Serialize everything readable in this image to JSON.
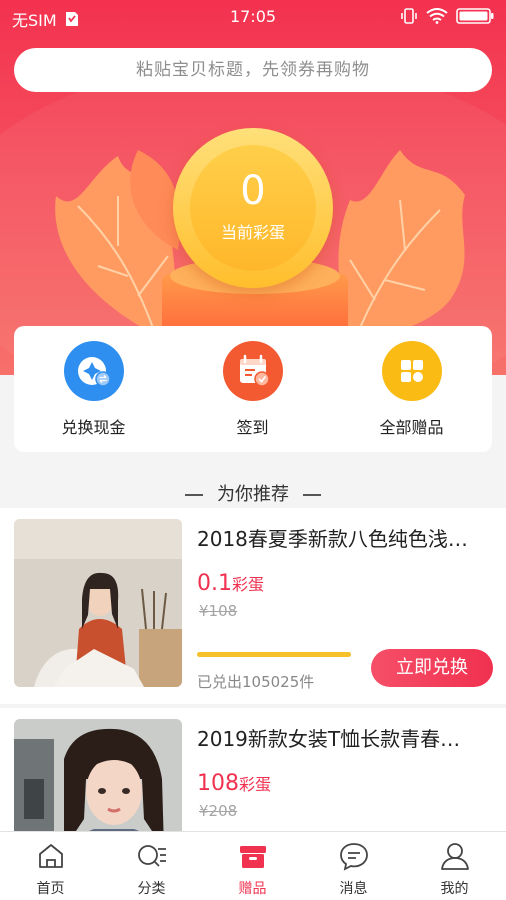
{
  "status_bar": {
    "carrier": "无SIM",
    "time": "17:05"
  },
  "search": {
    "placeholder": "粘贴宝贝标题，先领券再购物"
  },
  "balance": {
    "value": "0",
    "label": "当前彩蛋"
  },
  "actions": [
    {
      "label": "兑换现金",
      "icon": "exchange-cash-icon",
      "color": "#2f8ff0"
    },
    {
      "label": "签到",
      "icon": "calendar-checkin-icon",
      "color": "#f35a32"
    },
    {
      "label": "全部赠品",
      "icon": "grid-gifts-icon",
      "color": "#f9bb14"
    }
  ],
  "section_title": "为你推荐",
  "products": [
    {
      "title": "2018春夏季新款八色纯色浅…",
      "price": "0.1",
      "price_unit": "彩蛋",
      "original_price": "¥108",
      "progress": 1.0,
      "sold": "已兑出105025件",
      "button": "立即兑换"
    },
    {
      "title": "2019新款女装T恤长款青春…",
      "price": "108",
      "price_unit": "彩蛋",
      "original_price": "¥208"
    }
  ],
  "tabs": [
    {
      "label": "首页",
      "icon": "home-icon",
      "active": false
    },
    {
      "label": "分类",
      "icon": "search-list-icon",
      "active": false
    },
    {
      "label": "赠品",
      "icon": "gift-box-icon",
      "active": true
    },
    {
      "label": "消息",
      "icon": "chat-bubble-icon",
      "active": false
    },
    {
      "label": "我的",
      "icon": "user-icon",
      "active": false
    }
  ],
  "colors": {
    "brand": "#f0314f",
    "accent_yellow": "#f5c12a"
  }
}
